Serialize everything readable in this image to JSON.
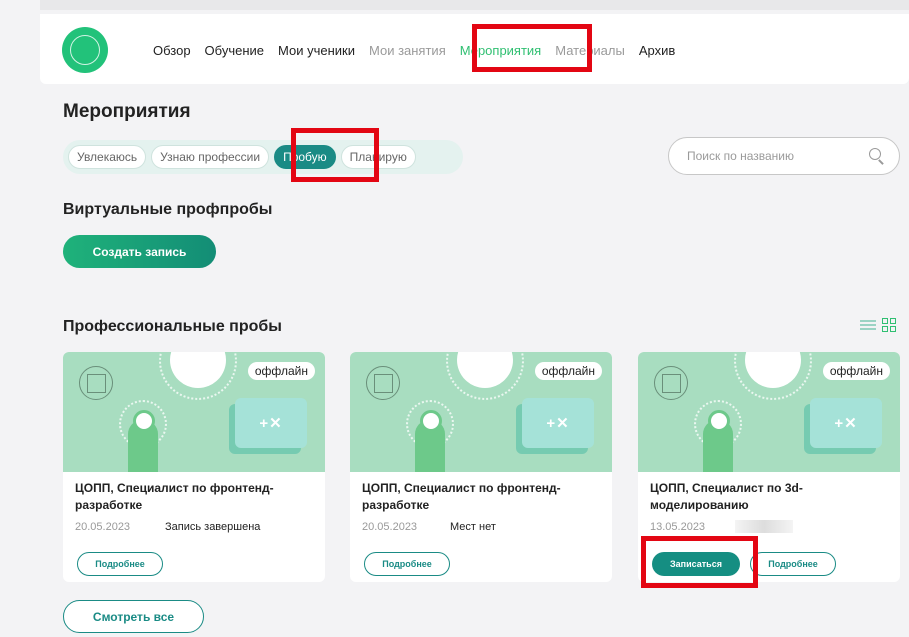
{
  "nav": {
    "items": [
      {
        "label": "Обзор",
        "state": "normal"
      },
      {
        "label": "Обучение",
        "state": "normal"
      },
      {
        "label": "Мои ученики",
        "state": "normal"
      },
      {
        "label": "Мои занятия",
        "state": "muted"
      },
      {
        "label": "Мероприятия",
        "state": "active"
      },
      {
        "label": "Материалы",
        "state": "muted"
      },
      {
        "label": "Архив",
        "state": "normal"
      }
    ]
  },
  "page": {
    "title": "Мероприятия"
  },
  "filters": {
    "chips": [
      "Увлекаюсь",
      "Узнаю профессии",
      "Пробую",
      "Планирую"
    ],
    "selected": "Пробую"
  },
  "search": {
    "placeholder": "Поиск по названию",
    "value": ""
  },
  "virtual": {
    "heading": "Виртуальные профпробы",
    "create_label": "Создать запись"
  },
  "professional": {
    "heading": "Профессиональные пробы",
    "cards": [
      {
        "badge": "оффлайн",
        "calc_symbols": "+✕",
        "title": "ЦОПП, Специалист по фронтенд-разработке",
        "date": "20.05.2023",
        "status": "Запись завершена",
        "details_label": "Подробнее"
      },
      {
        "badge": "оффлайн",
        "calc_symbols": "+✕",
        "title": "ЦОПП, Специалист по фронтенд-разработке",
        "date": "20.05.2023",
        "status": "Мест нет",
        "details_label": "Подробнее"
      },
      {
        "badge": "оффлайн",
        "calc_symbols": "+✕",
        "title": "ЦОПП, Специалист по 3d-моделированию",
        "date": "13.05.2023",
        "signup_label": "Записаться",
        "details_label": "Подробнее"
      }
    ],
    "see_all_label": "Смотреть все"
  },
  "colors": {
    "accent": "#1a8b85",
    "nav_active": "#2fbf71",
    "highlight": "#e30613",
    "card_image_bg": "#a8ddc0"
  }
}
